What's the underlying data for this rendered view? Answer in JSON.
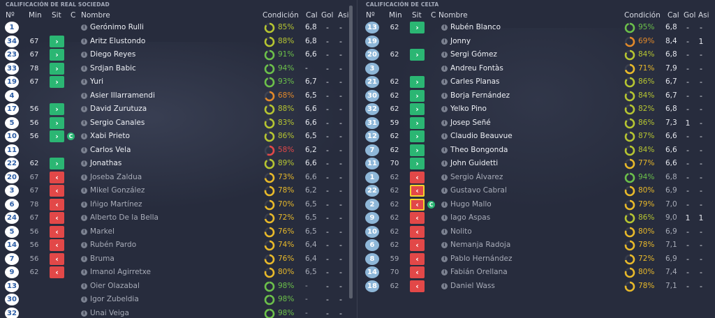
{
  "left": {
    "title": "CALIFICACIÓN DE REAL SOCIEDAD",
    "headers": {
      "num": "Nº",
      "min": "Min",
      "sit": "Sit",
      "c": "C",
      "nombre": "Nombre",
      "condicion": "Condición",
      "cal": "Cal",
      "gol": "Gol",
      "asi": "Asi"
    },
    "rows": [
      {
        "num": "1",
        "min": "",
        "sit": "",
        "cap": false,
        "name": "Gerónimo Rulli",
        "cond": "85%",
        "cal": "6,8",
        "gol": "-",
        "asi": "-",
        "sub": false
      },
      {
        "num": "34",
        "min": "67",
        "sit": "in",
        "cap": false,
        "name": "Aritz Elustondo",
        "cond": "88%",
        "cal": "6,8",
        "gol": "-",
        "asi": "-",
        "sub": false
      },
      {
        "num": "23",
        "min": "67",
        "sit": "in",
        "cap": false,
        "name": "Diego Reyes",
        "cond": "91%",
        "cal": "6,6",
        "gol": "-",
        "asi": "-",
        "sub": false
      },
      {
        "num": "33",
        "min": "78",
        "sit": "in",
        "cap": false,
        "name": "Srdjan Babic",
        "cond": "94%",
        "cal": "-",
        "gol": "-",
        "asi": "-",
        "sub": false
      },
      {
        "num": "19",
        "min": "67",
        "sit": "in",
        "cap": false,
        "name": "Yuri",
        "cond": "93%",
        "cal": "6,7",
        "gol": "-",
        "asi": "-",
        "sub": false
      },
      {
        "num": "4",
        "min": "",
        "sit": "",
        "cap": false,
        "name": "Asier Illarramendi",
        "cond": "68%",
        "cal": "6,5",
        "gol": "-",
        "asi": "-",
        "sub": false
      },
      {
        "num": "17",
        "min": "56",
        "sit": "in",
        "cap": false,
        "name": "David Zurutuza",
        "cond": "88%",
        "cal": "6,6",
        "gol": "-",
        "asi": "-",
        "sub": false
      },
      {
        "num": "5",
        "min": "56",
        "sit": "in",
        "cap": false,
        "name": "Sergio Canales",
        "cond": "83%",
        "cal": "6,6",
        "gol": "-",
        "asi": "-",
        "sub": false
      },
      {
        "num": "10",
        "min": "56",
        "sit": "in",
        "cap": true,
        "name": "Xabi Prieto",
        "cond": "86%",
        "cal": "6,5",
        "gol": "-",
        "asi": "-",
        "sub": false
      },
      {
        "num": "11",
        "min": "",
        "sit": "",
        "cap": false,
        "name": "Carlos Vela",
        "cond": "58%",
        "cal": "6,2",
        "gol": "-",
        "asi": "-",
        "sub": false
      },
      {
        "num": "22",
        "min": "62",
        "sit": "in",
        "cap": false,
        "name": "Jonathas",
        "cond": "89%",
        "cal": "6,6",
        "gol": "-",
        "asi": "-",
        "sub": false
      },
      {
        "num": "20",
        "min": "67",
        "sit": "out",
        "cap": false,
        "name": "Joseba Zaldua",
        "cond": "73%",
        "cal": "6,6",
        "gol": "-",
        "asi": "-",
        "sub": true
      },
      {
        "num": "3",
        "min": "67",
        "sit": "out",
        "cap": false,
        "name": "Mikel González",
        "cond": "78%",
        "cal": "6,2",
        "gol": "-",
        "asi": "-",
        "sub": true
      },
      {
        "num": "6",
        "min": "78",
        "sit": "out",
        "cap": false,
        "name": "Iñigo Martínez",
        "cond": "70%",
        "cal": "6,5",
        "gol": "-",
        "asi": "-",
        "sub": true
      },
      {
        "num": "24",
        "min": "67",
        "sit": "out",
        "cap": false,
        "name": "Alberto De la Bella",
        "cond": "72%",
        "cal": "6,5",
        "gol": "-",
        "asi": "-",
        "sub": true
      },
      {
        "num": "5",
        "min": "56",
        "sit": "out",
        "cap": false,
        "name": "Markel",
        "cond": "76%",
        "cal": "6,5",
        "gol": "-",
        "asi": "-",
        "sub": true
      },
      {
        "num": "14",
        "min": "56",
        "sit": "out",
        "cap": false,
        "name": "Rubén Pardo",
        "cond": "74%",
        "cal": "6,4",
        "gol": "-",
        "asi": "-",
        "sub": true
      },
      {
        "num": "7",
        "min": "56",
        "sit": "out",
        "cap": false,
        "name": "Bruma",
        "cond": "76%",
        "cal": "6,4",
        "gol": "-",
        "asi": "-",
        "sub": true
      },
      {
        "num": "9",
        "min": "62",
        "sit": "out",
        "cap": false,
        "name": "Imanol Agirretxe",
        "cond": "80%",
        "cal": "6,5",
        "gol": "-",
        "asi": "-",
        "sub": true
      },
      {
        "num": "13",
        "min": "",
        "sit": "",
        "cap": false,
        "name": "Oier Olazabal",
        "cond": "98%",
        "cal": "-",
        "gol": "-",
        "asi": "-",
        "sub": true
      },
      {
        "num": "30",
        "min": "",
        "sit": "",
        "cap": false,
        "name": "Igor Zubeldia",
        "cond": "98%",
        "cal": "-",
        "gol": "-",
        "asi": "-",
        "sub": true
      },
      {
        "num": "32",
        "min": "",
        "sit": "",
        "cap": false,
        "name": "Unai Veiga",
        "cond": "98%",
        "cal": "-",
        "gol": "-",
        "asi": "-",
        "sub": true
      }
    ]
  },
  "right": {
    "title": "CALIFICACIÓN DE CELTA",
    "headers": {
      "num": "Nº",
      "min": "Min",
      "sit": "Sit",
      "c": "C",
      "nombre": "Nombre",
      "condicion": "Condición",
      "cal": "Cal",
      "gol": "Gol",
      "asi": "Asi"
    },
    "rows": [
      {
        "num": "13",
        "min": "62",
        "sit": "in",
        "cap": false,
        "name": "Rubén Blanco",
        "cond": "95%",
        "cal": "6,8",
        "gol": "-",
        "asi": "-",
        "sub": false,
        "link": false
      },
      {
        "num": "19",
        "min": "",
        "sit": "",
        "cap": false,
        "name": "Jonny",
        "cond": "69%",
        "cal": "8,4",
        "gol": "-",
        "asi": "1",
        "sub": false,
        "link": false
      },
      {
        "num": "20",
        "min": "62",
        "sit": "in",
        "cap": false,
        "name": "Sergi Gómez",
        "cond": "84%",
        "cal": "6,8",
        "gol": "-",
        "asi": "-",
        "sub": false,
        "link": false
      },
      {
        "num": "3",
        "min": "",
        "sit": "",
        "cap": false,
        "name": "Andreu Fontàs",
        "cond": "71%",
        "cal": "7,9",
        "gol": "-",
        "asi": "-",
        "sub": false,
        "link": false
      },
      {
        "num": "21",
        "min": "62",
        "sit": "in",
        "cap": false,
        "name": "Carles Planas",
        "cond": "86%",
        "cal": "6,7",
        "gol": "-",
        "asi": "-",
        "sub": false,
        "link": false
      },
      {
        "num": "30",
        "min": "62",
        "sit": "in",
        "cap": false,
        "name": "Borja Fernández",
        "cond": "84%",
        "cal": "6,7",
        "gol": "-",
        "asi": "-",
        "sub": false,
        "link": false
      },
      {
        "num": "32",
        "min": "62",
        "sit": "in",
        "cap": false,
        "name": "Yelko Pino",
        "cond": "82%",
        "cal": "6,8",
        "gol": "-",
        "asi": "-",
        "sub": false,
        "link": false
      },
      {
        "num": "31",
        "min": "59",
        "sit": "in",
        "cap": false,
        "name": "Josep Señé",
        "cond": "86%",
        "cal": "7,3",
        "gol": "1",
        "asi": "-",
        "sub": false,
        "link": false
      },
      {
        "num": "12",
        "min": "62",
        "sit": "in",
        "cap": false,
        "name": "Claudio Beauvue",
        "cond": "87%",
        "cal": "6,6",
        "gol": "-",
        "asi": "-",
        "sub": false,
        "link": false
      },
      {
        "num": "7",
        "min": "62",
        "sit": "in",
        "cap": false,
        "name": "Theo Bongonda",
        "cond": "84%",
        "cal": "6,6",
        "gol": "-",
        "asi": "-",
        "sub": false,
        "link": false
      },
      {
        "num": "11",
        "min": "70",
        "sit": "in",
        "cap": false,
        "name": "John Guidetti",
        "cond": "77%",
        "cal": "6,6",
        "gol": "-",
        "asi": "-",
        "sub": false,
        "link": false
      },
      {
        "num": "1",
        "min": "62",
        "sit": "out",
        "cap": false,
        "name": "Sergio Álvarez",
        "cond": "94%",
        "cal": "6,8",
        "gol": "-",
        "asi": "-",
        "sub": true,
        "link": false
      },
      {
        "num": "22",
        "min": "62",
        "sit": "out",
        "yellow": true,
        "cap": false,
        "name": "Gustavo Cabral",
        "cond": "80%",
        "cal": "6,9",
        "gol": "-",
        "asi": "-",
        "sub": true,
        "link": false
      },
      {
        "num": "2",
        "min": "62",
        "sit": "out",
        "yellow": true,
        "cap": true,
        "name": "Hugo Mallo",
        "cond": "79%",
        "cal": "7,0",
        "gol": "-",
        "asi": "-",
        "sub": true,
        "link": false
      },
      {
        "num": "9",
        "min": "62",
        "sit": "out",
        "cap": false,
        "name": "Iago Aspas",
        "cond": "86%",
        "cal": "9,0",
        "gol": "1",
        "asi": "1",
        "sub": true,
        "link": true
      },
      {
        "num": "10",
        "min": "62",
        "sit": "out",
        "cap": false,
        "name": "Nolito",
        "cond": "80%",
        "cal": "6,9",
        "gol": "-",
        "asi": "-",
        "sub": true,
        "link": false
      },
      {
        "num": "6",
        "min": "62",
        "sit": "out",
        "cap": false,
        "name": "Nemanja Radoja",
        "cond": "78%",
        "cal": "7,1",
        "gol": "-",
        "asi": "-",
        "sub": true,
        "link": false
      },
      {
        "num": "8",
        "min": "59",
        "sit": "out",
        "cap": false,
        "name": "Pablo Hernández",
        "cond": "72%",
        "cal": "6,9",
        "gol": "-",
        "asi": "-",
        "sub": true,
        "link": false
      },
      {
        "num": "14",
        "min": "70",
        "sit": "out",
        "cap": false,
        "name": "Fabián Orellana",
        "cond": "80%",
        "cal": "7,4",
        "gol": "-",
        "asi": "-",
        "sub": true,
        "link": false
      },
      {
        "num": "18",
        "min": "62",
        "sit": "out",
        "cap": false,
        "name": "Daniel Wass",
        "cond": "78%",
        "cal": "7,1",
        "gol": "-",
        "asi": "-",
        "sub": true,
        "link": false
      }
    ]
  },
  "colors": {
    "green": "#6cc04a",
    "yellow_green": "#b6c531",
    "yellow": "#e8b92a",
    "orange": "#e2892a",
    "red": "#e24848",
    "in": "#2bb673",
    "out": "#e24848"
  },
  "icons": {
    "in": "chevron-right-icon",
    "out": "chevron-left-icon",
    "info": "info-icon",
    "captain": "captain-badge"
  }
}
